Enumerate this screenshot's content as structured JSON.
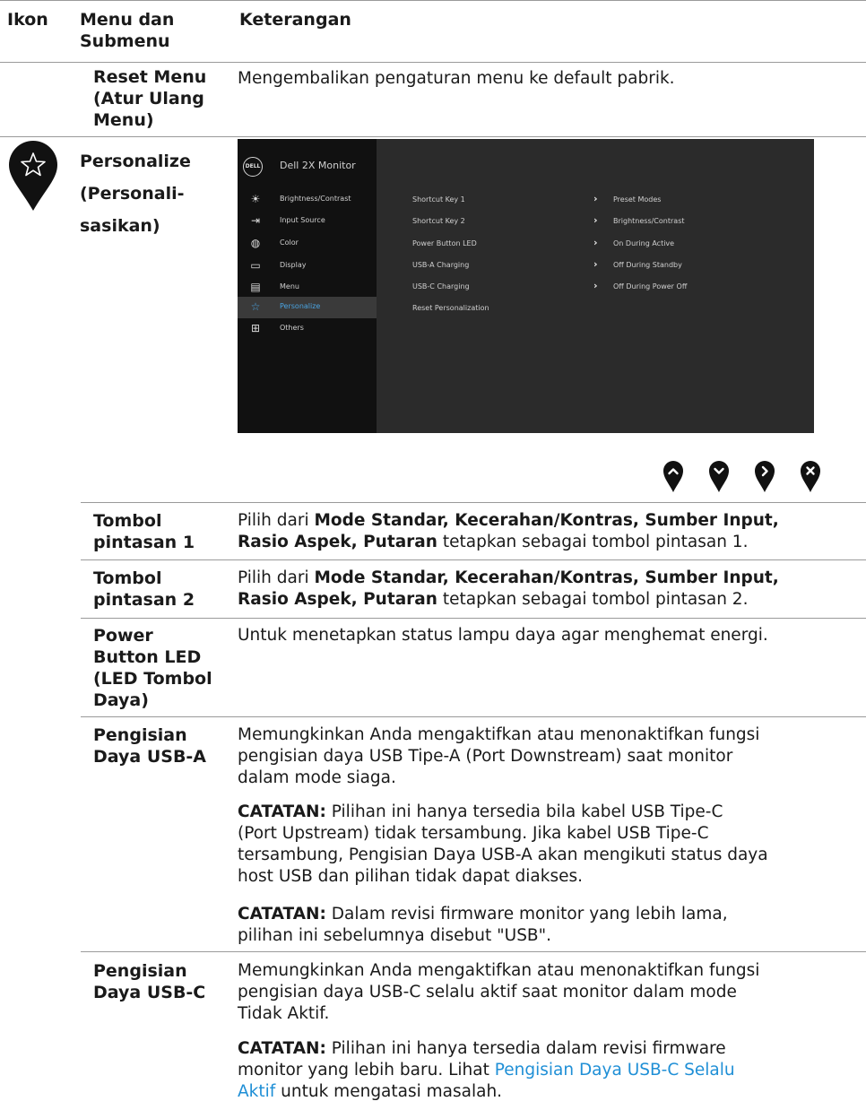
{
  "header": {
    "col1": "Ikon",
    "col2": [
      "Menu dan",
      "Submenu"
    ],
    "col3": "Keterangan"
  },
  "reset": {
    "label": [
      "Reset Menu",
      "(Atur Ulang",
      "Menu)"
    ],
    "desc": "Mengembalikan pengaturan menu ke default pabrik."
  },
  "personalize": {
    "label": [
      "Personalize",
      "(Personali-",
      "sasikan)"
    ],
    "icon": "star-icon"
  },
  "osd": {
    "brand": "DELL",
    "title": "Dell 2X Monitor",
    "menu": [
      {
        "label": "Brightness/Contrast",
        "icon": "brightness-icon"
      },
      {
        "label": "Input Source",
        "icon": "input-icon"
      },
      {
        "label": "Color",
        "icon": "color-icon"
      },
      {
        "label": "Display",
        "icon": "display-icon"
      },
      {
        "label": "Menu",
        "icon": "menu-icon"
      },
      {
        "label": "Personalize",
        "icon": "star-icon"
      },
      {
        "label": "Others",
        "icon": "others-icon"
      }
    ],
    "active_index": 5,
    "rows": [
      {
        "key": "Shortcut Key 1",
        "value": "Preset Modes"
      },
      {
        "key": "Shortcut Key 2",
        "value": "Brightness/Contrast"
      },
      {
        "key": "Power Button LED",
        "value": "On During Active"
      },
      {
        "key": "USB-A Charging",
        "value": "Off During Standby"
      },
      {
        "key": "USB-C Charging",
        "value": "Off During Power Off"
      },
      {
        "key": "Reset Personalization",
        "value": ""
      }
    ],
    "accent": "#4aa3e0"
  },
  "nav_buttons": [
    "up-button",
    "down-button",
    "right-button",
    "close-button"
  ],
  "items": {
    "sk1": {
      "label": [
        "Tombol",
        "pintasan 1"
      ],
      "pre": "Pilih dari ",
      "bold1": "Mode Standar, Kecerahan/Kontras, Sumber Input,",
      "bold2": "Rasio Aspek, Putaran",
      "post": " tetapkan sebagai tombol pintasan 1."
    },
    "sk2": {
      "label": [
        "Tombol",
        "pintasan 2"
      ],
      "pre": "Pilih dari ",
      "bold1": "Mode Standar, Kecerahan/Kontras, Sumber Input,",
      "bold2": "Rasio Aspek, Putaran",
      "post": " tetapkan sebagai tombol pintasan 2."
    },
    "led": {
      "label": [
        "Power",
        "Button LED",
        "(LED Tombol",
        "Daya)"
      ],
      "desc": "Untuk menetapkan status lampu daya agar menghemat energi."
    },
    "usba": {
      "label": [
        "Pengisian",
        "Daya USB-A"
      ],
      "desc": [
        "Memungkinkan Anda mengaktifkan atau menonaktifkan fungsi",
        "pengisian daya USB Tipe-A (Port Downstream) saat monitor",
        "dalam mode siaga."
      ],
      "note1_label": "CATATAN:",
      "note1": [
        " Pilihan ini hanya tersedia bila kabel USB Tipe-C",
        "(Port Upstream) tidak tersambung. Jika kabel USB Tipe-C",
        "tersambung, Pengisian Daya USB-A akan mengikuti status daya",
        "host USB dan pilihan tidak dapat diakses."
      ],
      "note2_label": "CATATAN:",
      "note2": [
        " Dalam revisi firmware monitor yang lebih lama,",
        "pilihan ini sebelumnya disebut \"USB\"."
      ]
    },
    "usbc": {
      "label": [
        "Pengisian",
        "Daya USB-C"
      ],
      "desc": [
        "Memungkinkan Anda mengaktifkan atau menonaktifkan fungsi",
        "pengisian daya USB-C selalu aktif saat monitor dalam mode",
        "Tidak Aktif."
      ],
      "note_label": "CATATAN:",
      "note_l1": " Pilihan ini hanya tersedia dalam revisi firmware",
      "note_l2_pre": "monitor yang lebih baru. Lihat ",
      "note_link_a": "Pengisian Daya USB-C Selalu",
      "note_link_b": "Aktif",
      "note_l3_post": " untuk mengatasi masalah."
    }
  }
}
